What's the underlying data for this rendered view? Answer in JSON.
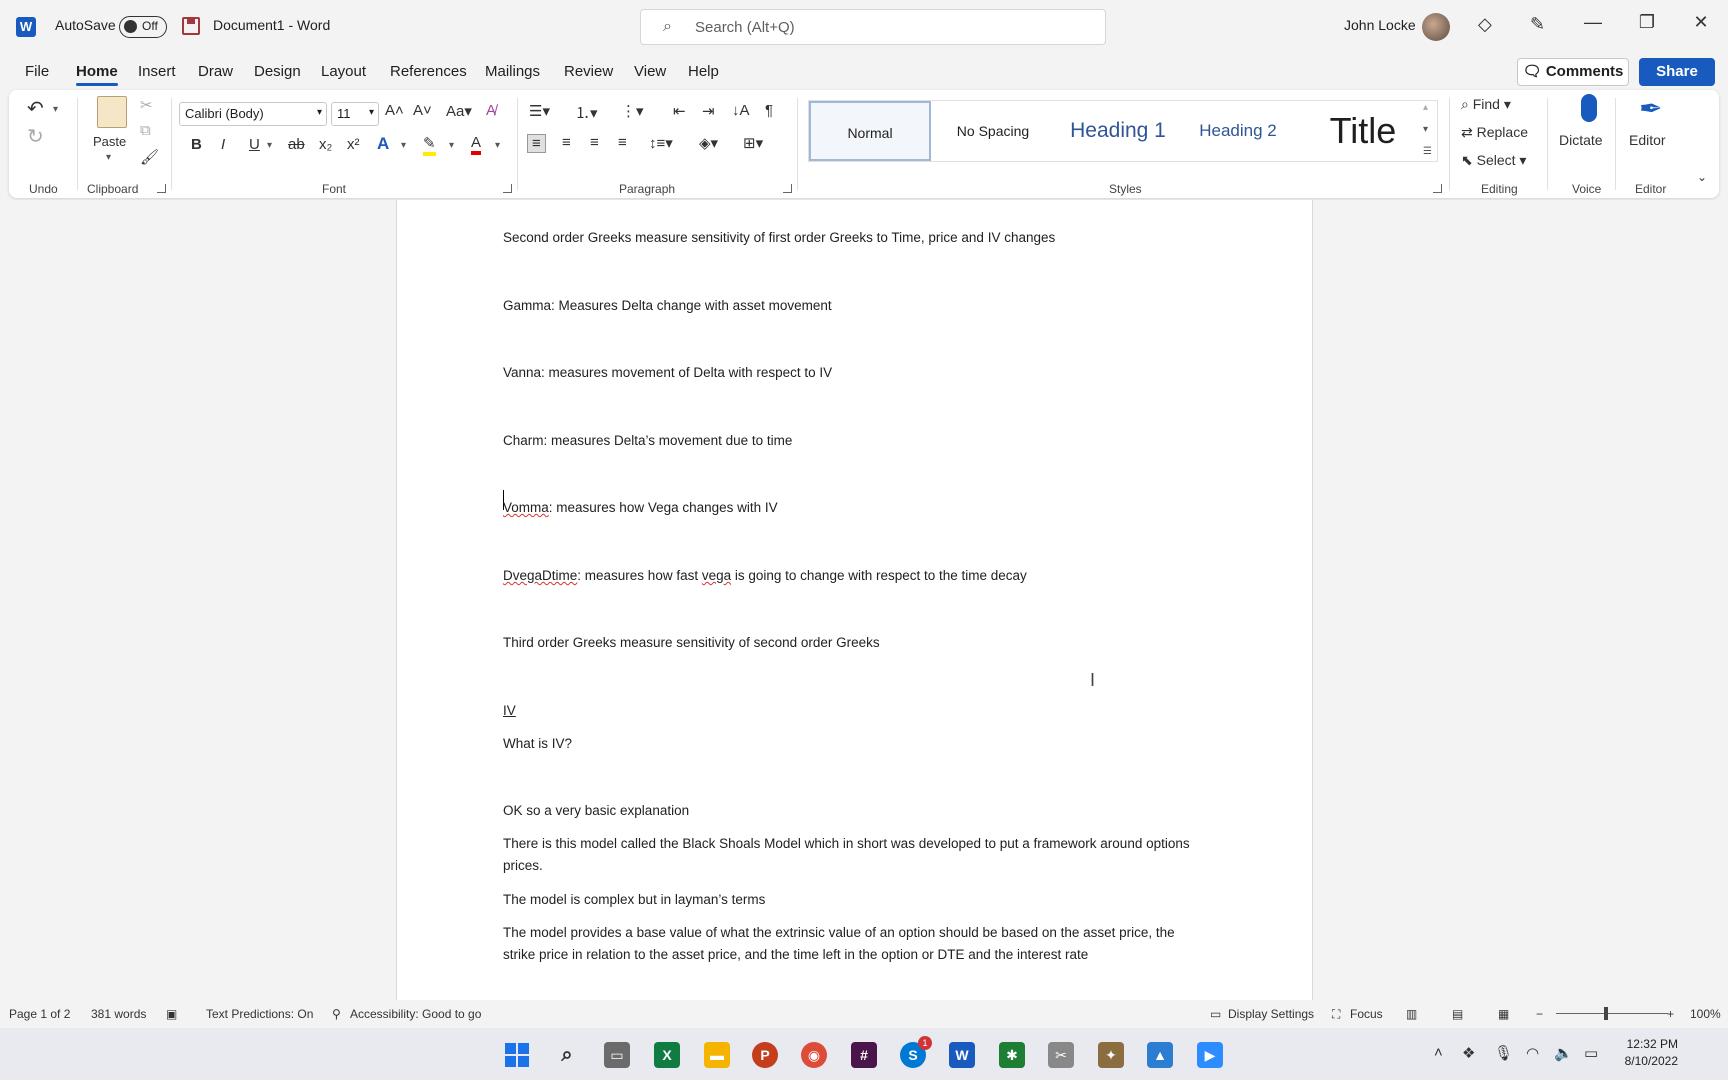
{
  "titlebar": {
    "logo": "W",
    "autosave_label": "AutoSave",
    "autosave_state": "Off",
    "document_name": "Document1  -  Word",
    "search_placeholder": "Search (Alt+Q)",
    "user_name": "John Locke"
  },
  "menu": {
    "tabs": [
      "File",
      "Home",
      "Insert",
      "Draw",
      "Design",
      "Layout",
      "References",
      "Mailings",
      "Review",
      "View",
      "Help"
    ],
    "active": "Home",
    "comments_label": "Comments",
    "share_label": "Share"
  },
  "ribbon": {
    "groups": {
      "undo": "Undo",
      "clipboard": "Clipboard",
      "font": "Font",
      "paragraph": "Paragraph",
      "styles": "Styles",
      "editing": "Editing",
      "voice": "Voice",
      "editor": "Editor"
    },
    "paste_label": "Paste",
    "font_name": "Calibri (Body)",
    "font_size": "11",
    "styles": [
      "Normal",
      "No Spacing",
      "Heading 1",
      "Heading 2",
      "Title"
    ],
    "find_label": "Find",
    "replace_label": "Replace",
    "select_label": "Select",
    "dictate_label": "Dictate",
    "editor_label": "Editor"
  },
  "document": {
    "paragraphs": [
      "Second order Greeks measure sensitivity of first order Greeks to Time, price and IV changes",
      "Gamma: Measures Delta change with asset movement",
      "Vanna: measures movement of Delta with respect to IV",
      "Charm: measures Delta’s movement due to time",
      "Vomma: measures how Vega changes with IV",
      "DvegaDtime: measures how fast vega is going to change with respect to the time decay",
      "Third order Greeks measure sensitivity of second order Greeks",
      "IV",
      "What is IV?",
      "OK so a very basic explanation",
      "There is this model called the Black Shoals Model which in short was developed to put a framework around options prices.",
      "The model is complex but in layman’s terms",
      "The model provides a base value of what the extrinsic value of an option should be based on the asset price, the strike price in relation to the asset price, and the time left in the option or DTE and the interest rate"
    ]
  },
  "statusbar": {
    "page": "Page 1 of 2",
    "words": "381 words",
    "predictions": "Text Predictions: On",
    "accessibility": "Accessibility: Good to go",
    "display_settings": "Display Settings",
    "focus": "Focus",
    "zoom": "100%"
  },
  "taskbar": {
    "time": "12:32 PM",
    "date": "8/10/2022",
    "skype_badge": "1"
  },
  "colors": {
    "accent": "#185abd",
    "spell_error": "#d13438"
  }
}
